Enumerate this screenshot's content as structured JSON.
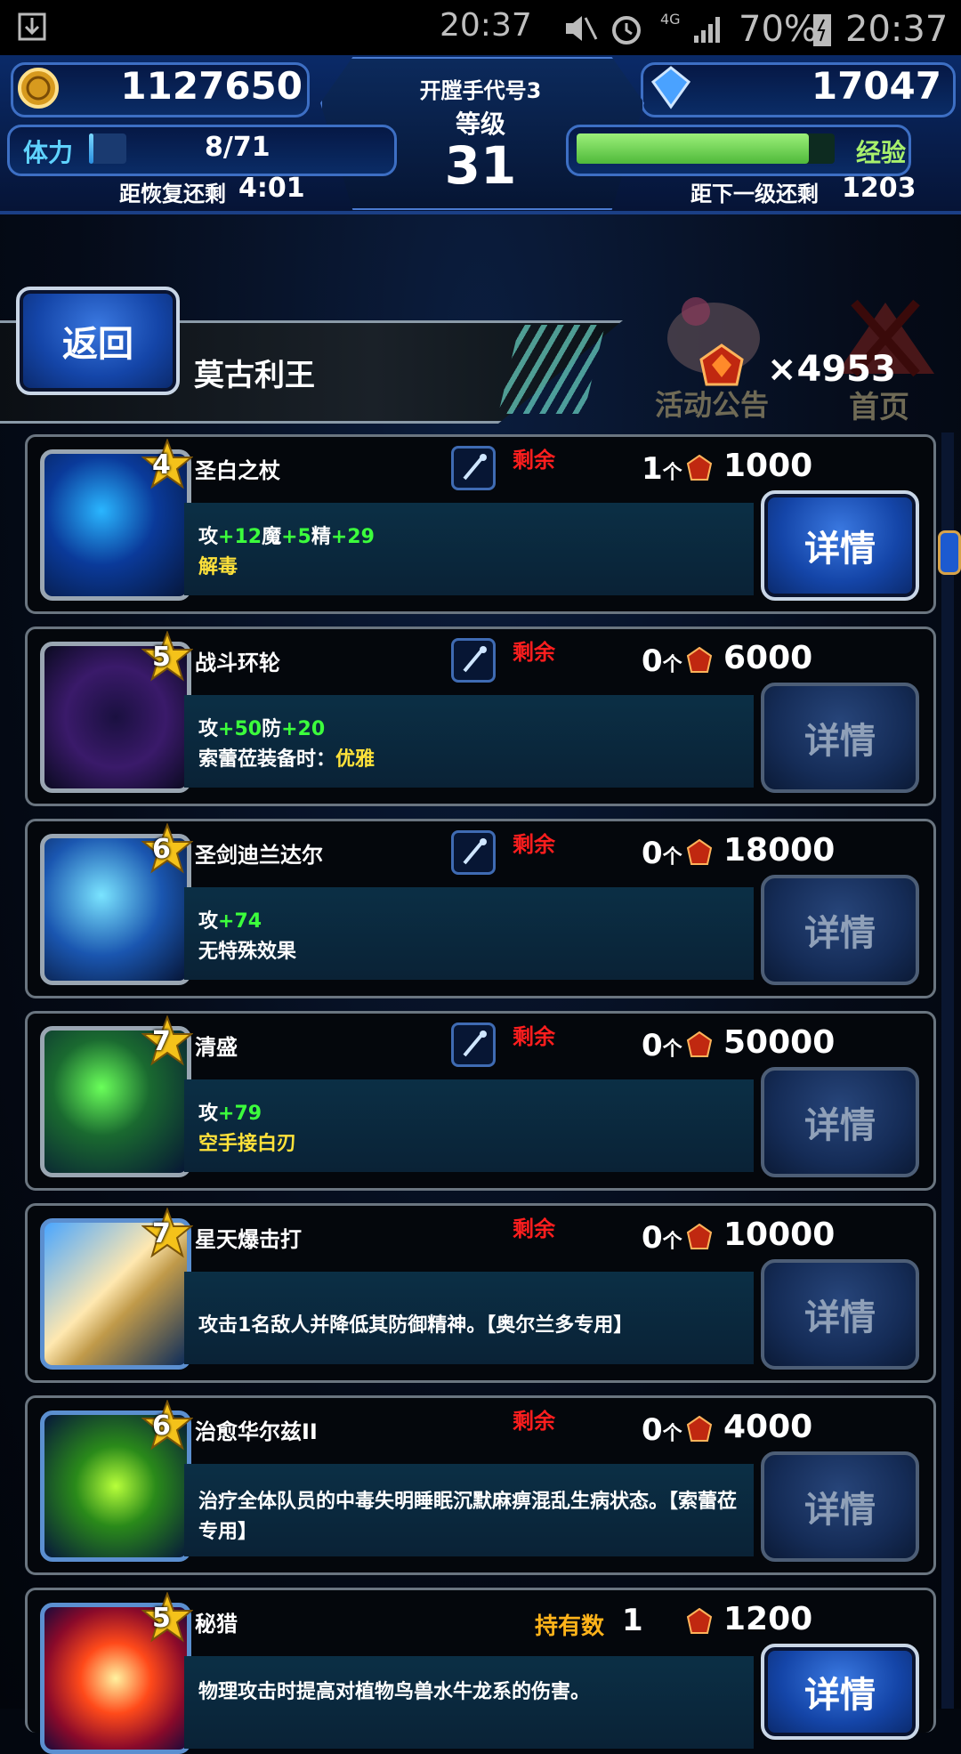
{
  "status_bar": {
    "time": "20:37",
    "network": "4G",
    "battery": "70%",
    "clock_right": "20:37"
  },
  "header": {
    "gil": "1127650",
    "player_name": "开膛手代号3",
    "level_label": "等级",
    "level": "31",
    "gems": "17047",
    "stamina_label": "体力",
    "stamina": "8/71",
    "stamina_fraction": 0.11,
    "recover_label": "距恢复还剩",
    "recover_time": "4:01",
    "exp_label": "经验",
    "exp_fraction": 0.9,
    "next_level_label": "距下一级还剩",
    "next_level": "1203"
  },
  "nav": {
    "back_label": "返回",
    "page_title": "莫古利王",
    "event_label": "活动公告",
    "home_label": "首页",
    "currency_count": "×4953"
  },
  "items": [
    {
      "stars": "4",
      "name": "圣白之杖",
      "tag": "剩余",
      "type_icon": "staff-icon",
      "count": "1",
      "unit": "个",
      "price": "1000",
      "stats": [
        [
          "攻",
          "+12"
        ],
        [
          "魔",
          "+5"
        ],
        [
          "精",
          "+29"
        ]
      ],
      "effect_prefix": "",
      "effect": "解毒",
      "detail": "详情",
      "active": true,
      "thumb": "staff"
    },
    {
      "stars": "5",
      "name": "战斗环轮",
      "tag": "剩余",
      "type_icon": "ring-icon",
      "count": "0",
      "unit": "个",
      "price": "6000",
      "stats": [
        [
          "攻",
          "+50"
        ],
        [
          "防",
          "+20"
        ]
      ],
      "effect_prefix": "索蕾莅装备时：",
      "effect": "优雅",
      "detail": "详情",
      "active": false,
      "thumb": "ring"
    },
    {
      "stars": "6",
      "name": "圣剑迪兰达尔",
      "tag": "剩余",
      "type_icon": "sword-icon",
      "count": "0",
      "unit": "个",
      "price": "18000",
      "stats": [
        [
          "攻",
          "+74"
        ]
      ],
      "effect_prefix": "",
      "effect_plain": "无特殊效果",
      "detail": "详情",
      "active": false,
      "thumb": "sword"
    },
    {
      "stars": "7",
      "name": "清盛",
      "tag": "剩余",
      "type_icon": "katana-icon",
      "count": "0",
      "unit": "个",
      "price": "50000",
      "stats": [
        [
          "攻",
          "+79"
        ]
      ],
      "effect_prefix": "",
      "effect": "空手接白刃",
      "detail": "详情",
      "active": false,
      "thumb": "katana"
    },
    {
      "stars": "7",
      "name": "星天爆击打",
      "tag": "剩余",
      "count": "0",
      "unit": "个",
      "price": "10000",
      "desc": "攻击1名敌人并降低其防御精神。【奥尔兰多专用】",
      "detail": "详情",
      "active": false,
      "thumb": "ability-slash"
    },
    {
      "stars": "6",
      "name": "治愈华尔兹II",
      "tag": "剩余",
      "count": "0",
      "unit": "个",
      "price": "4000",
      "desc": "治疗全体队员的中毒失明睡眠沉默麻痹混乱生病状态。【索蕾莅专用】",
      "detail": "详情",
      "active": false,
      "thumb": "ability-music"
    },
    {
      "stars": "5",
      "name": "秘猎",
      "held_label": "持有数",
      "held": "1",
      "price": "1200",
      "desc": "物理攻击时提高对植物鸟兽水牛龙系的伤害。",
      "detail": "详情",
      "active": true,
      "thumb": "ability-fire"
    }
  ]
}
